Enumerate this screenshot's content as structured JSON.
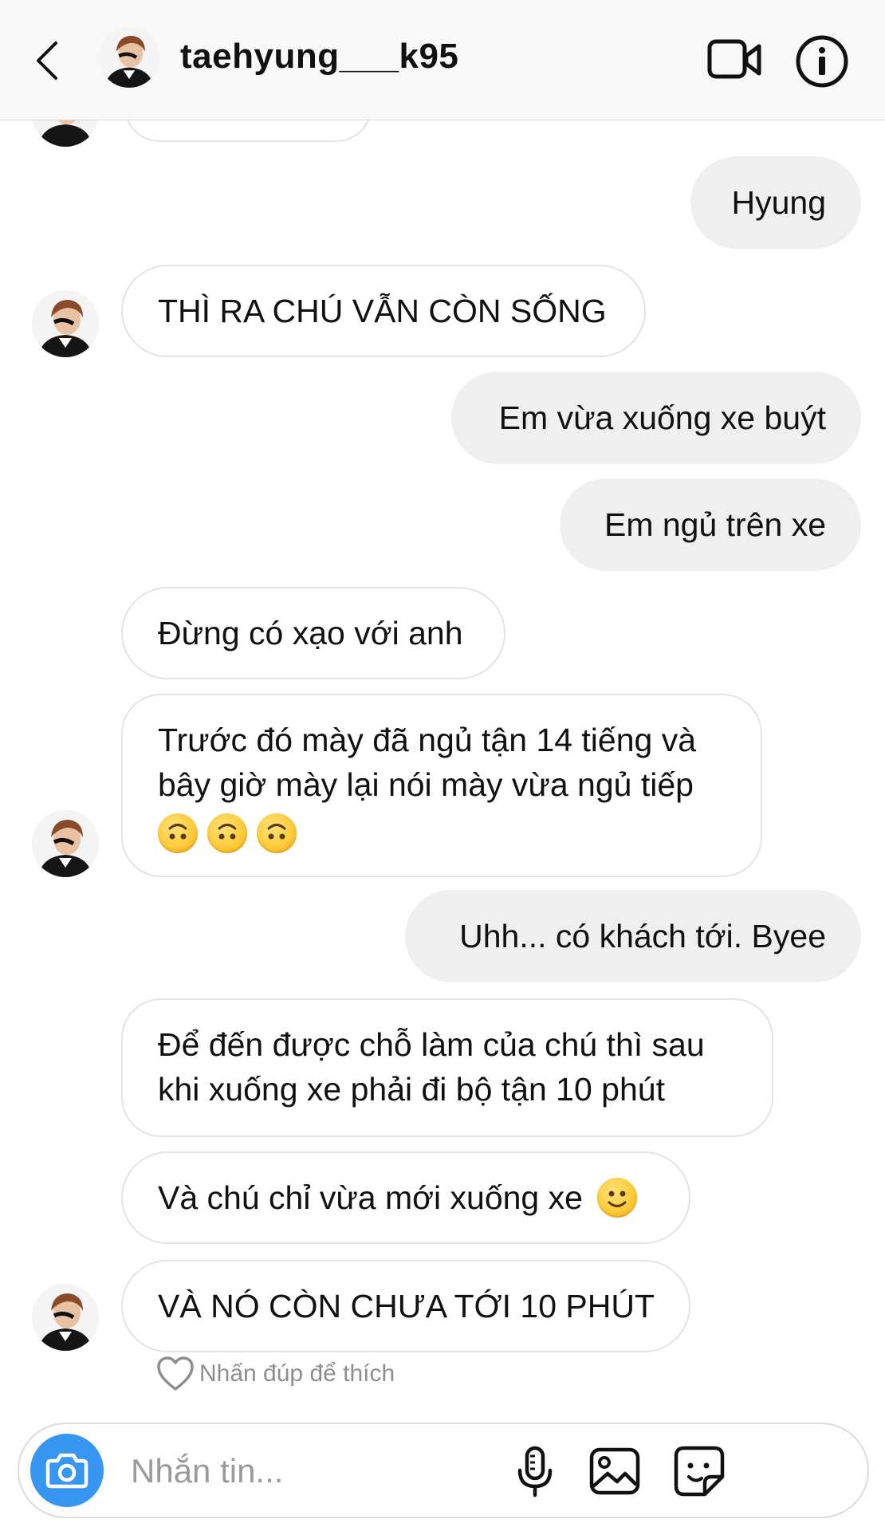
{
  "header": {
    "username": "taehyung___k95",
    "icons": {
      "back": "chevron-left-icon",
      "video": "video-camera-icon",
      "info": "info-icon"
    }
  },
  "messages": [
    {
      "side": "in",
      "text": ""
    },
    {
      "side": "out",
      "text": "Hyung"
    },
    {
      "side": "in",
      "text": "THÌ RA CHÚ VẪN CÒN SỐNG"
    },
    {
      "side": "out",
      "text": "Em vừa xuống xe buýt"
    },
    {
      "side": "out",
      "text": "Em ngủ trên xe"
    },
    {
      "side": "in",
      "text": "Đừng có xạo với anh"
    },
    {
      "side": "in",
      "line1": "Trước đó mày đã ngủ tận 14 tiếng và",
      "line2": "bây giờ mày lại nói mày vừa ngủ tiếp",
      "emoji": "upside-down-face-emoji",
      "emoji_count": 3
    },
    {
      "side": "out",
      "text": "Uhh... có khách tới. Byee"
    },
    {
      "side": "in",
      "line1": "Để đến được chỗ làm của chú thì sau",
      "line2": "khi xuống xe phải đi bộ tận 10 phút"
    },
    {
      "side": "in",
      "text": "Và chú chỉ vừa mới xuống xe",
      "emoji": "slightly-smiling-face-emoji"
    },
    {
      "side": "in",
      "text": "VÀ NÓ CÒN CHƯA TỚI 10 PHÚT"
    }
  ],
  "like_hint": "Nhấn đúp để thích",
  "composer": {
    "placeholder": "Nhắn tin...",
    "value": "",
    "icons": [
      "camera-icon",
      "microphone-icon",
      "gallery-icon",
      "sticker-icon"
    ]
  },
  "colors": {
    "accent": "#3797f0",
    "outgoing_bubble": "#efefef",
    "incoming_border": "#e3e3e3"
  }
}
